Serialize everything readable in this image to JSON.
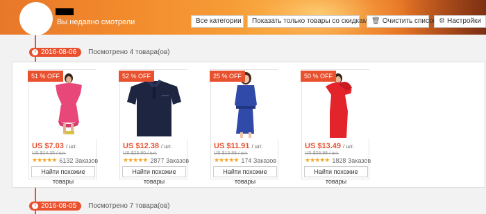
{
  "header": {
    "title": "Вы недавно смотрели",
    "category_select": "Все категории",
    "discount_button": "Показать только товары со скидками",
    "clear_button": "Очистить список",
    "settings_button": "Настройки"
  },
  "groups": [
    {
      "date": "2016-08-06",
      "viewed": "Посмотрено 4 товара(ов)",
      "products": [
        {
          "badge": "51 % OFF",
          "price": "US $7.03",
          "unit": "/ шт.",
          "old_price": "US $14.35 / шт.",
          "orders": "6132 Заказов",
          "similar": "Найти похожие товары",
          "image": "pink-off-shoulder-dress"
        },
        {
          "badge": "52 % OFF",
          "price": "US $12.38",
          "unit": "/ шт.",
          "old_price": "US $25.80 / шт.",
          "orders": "2877 Заказов",
          "similar": "Найти похожие товары",
          "image": "navy-polo-shirt"
        },
        {
          "badge": "25 % OFF",
          "price": "US $11.91",
          "unit": "/ шт.",
          "old_price": "US $15.88 / шт.",
          "orders": "174 Заказов",
          "similar": "Найти похожие товары",
          "image": "blue-shirt-dress"
        },
        {
          "badge": "50 % OFF",
          "price": "US $13.49",
          "unit": "/ шт.",
          "old_price": "US $26.98 / шт.",
          "orders": "1828 Заказов",
          "similar": "Найти похожие товары",
          "image": "red-ruffle-dress"
        }
      ]
    },
    {
      "date": "2016-08-05",
      "viewed": "Посмотрено 7 товара(ов)"
    }
  ],
  "colors": {
    "accent": "#e8502e",
    "stars": "#f5a623"
  }
}
